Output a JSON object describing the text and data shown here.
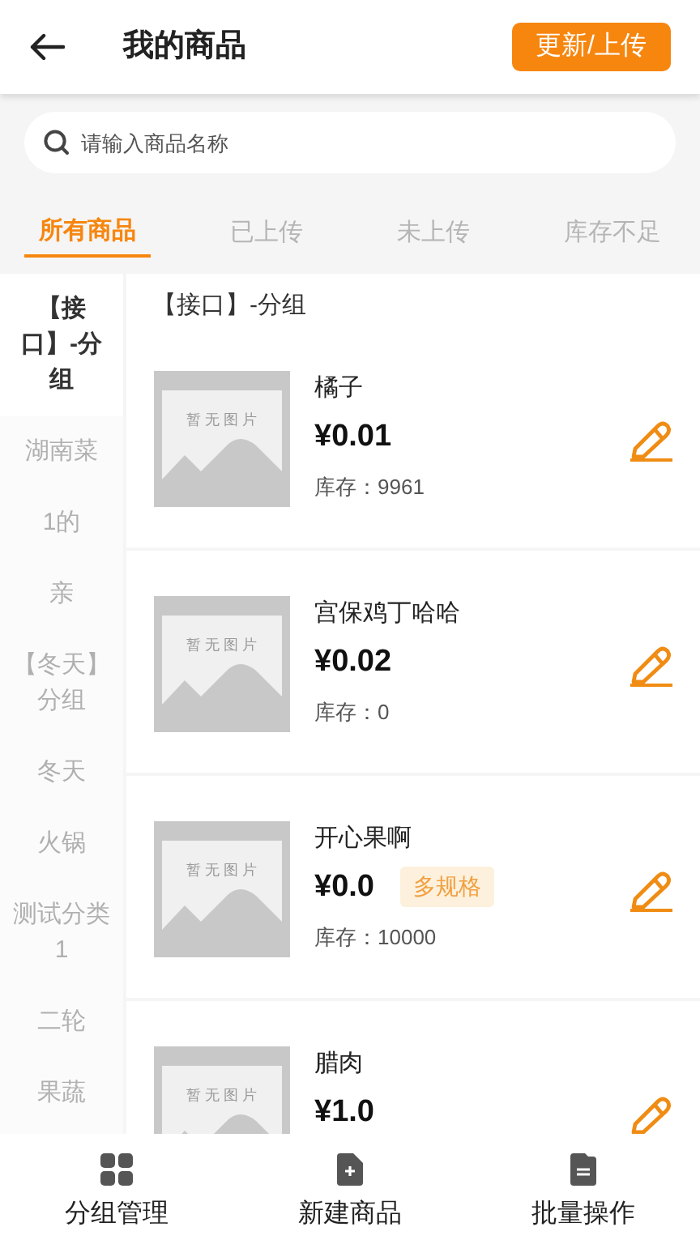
{
  "header": {
    "title": "我的商品",
    "action_button": "更新/上传"
  },
  "search": {
    "placeholder": "请输入商品名称"
  },
  "tabs": [
    {
      "label": "所有商品",
      "selected": true
    },
    {
      "label": "已上传",
      "selected": false
    },
    {
      "label": "未上传",
      "selected": false
    },
    {
      "label": "库存不足",
      "selected": false
    }
  ],
  "sidebar": {
    "items": [
      {
        "label": "【接口】-分组",
        "selected": true
      },
      {
        "label": "湖南菜",
        "selected": false
      },
      {
        "label": "1的",
        "selected": false
      },
      {
        "label": "亲",
        "selected": false
      },
      {
        "label": "【冬天】分组",
        "selected": false
      },
      {
        "label": "冬天",
        "selected": false
      },
      {
        "label": "火锅",
        "selected": false
      },
      {
        "label": "测试分类1",
        "selected": false
      },
      {
        "label": "二轮",
        "selected": false
      },
      {
        "label": "果蔬",
        "selected": false
      }
    ]
  },
  "group_title": "【接口】-分组",
  "products": [
    {
      "image_placeholder": "暂 无 图 片",
      "name": "橘子",
      "price": "¥0.01",
      "stock": "库存：9961"
    },
    {
      "image_placeholder": "暂 无 图 片",
      "name": "宫保鸡丁哈哈",
      "price": "¥0.02",
      "stock": "库存：0"
    },
    {
      "image_placeholder": "暂 无 图 片",
      "name": "开心果啊",
      "price": "¥0.0",
      "tag": "多规格",
      "stock": "库存：10000"
    },
    {
      "image_placeholder": "暂 无 图 片",
      "name": "腊肉",
      "price": "¥1.0"
    }
  ],
  "bottom_nav": [
    {
      "kind": "grid",
      "label": "分组管理"
    },
    {
      "kind": "new",
      "label": "新建商品"
    },
    {
      "kind": "batch",
      "label": "批量操作"
    }
  ]
}
